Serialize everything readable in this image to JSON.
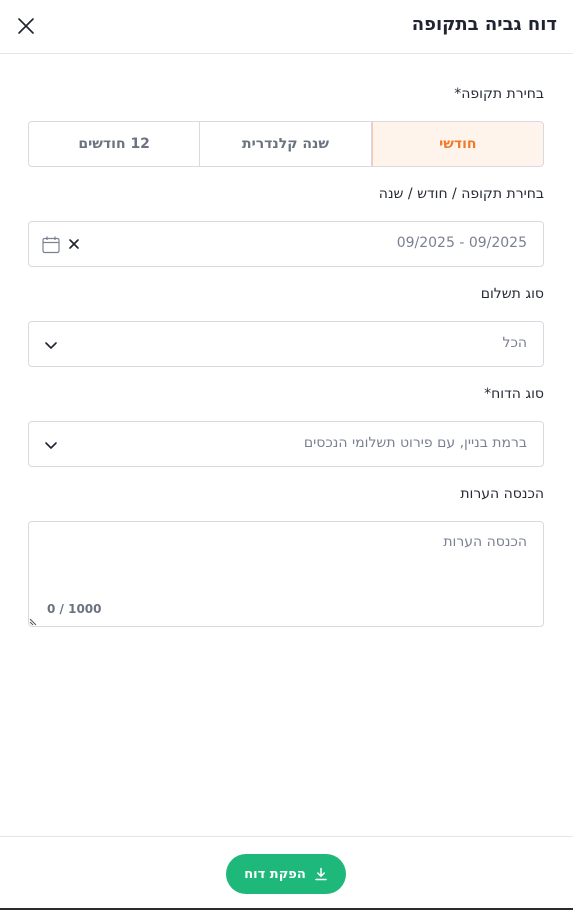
{
  "header": {
    "title": "דוח גביה בתקופה",
    "close_icon": "close-icon"
  },
  "period": {
    "label": "בחירת תקופה*",
    "options": [
      "חודשי",
      "שנה קלנדרית",
      "12 חודשים"
    ],
    "selected": "חודשי"
  },
  "date_range": {
    "label": "בחירת תקופה / חודש / שנה",
    "value": "09/2025 - 09/2025",
    "calendar_icon": "calendar-icon",
    "clear_icon": "clear-icon"
  },
  "payment_type": {
    "label": "סוג תשלום",
    "value": "הכל"
  },
  "report_type": {
    "label": "סוג הדוח*",
    "value": "ברמת בניין, עם פירוט תשלומי הנכסים"
  },
  "notes": {
    "label": "הכנסה הערות",
    "placeholder": "הכנסה הערות",
    "counter": "0 / 1000"
  },
  "footer": {
    "submit_label": "הפקת דוח",
    "submit_icon": "download-icon"
  },
  "colors": {
    "accent": "#f07a2a",
    "accent_bg": "#fff4ec",
    "primary": "#1db87a"
  }
}
